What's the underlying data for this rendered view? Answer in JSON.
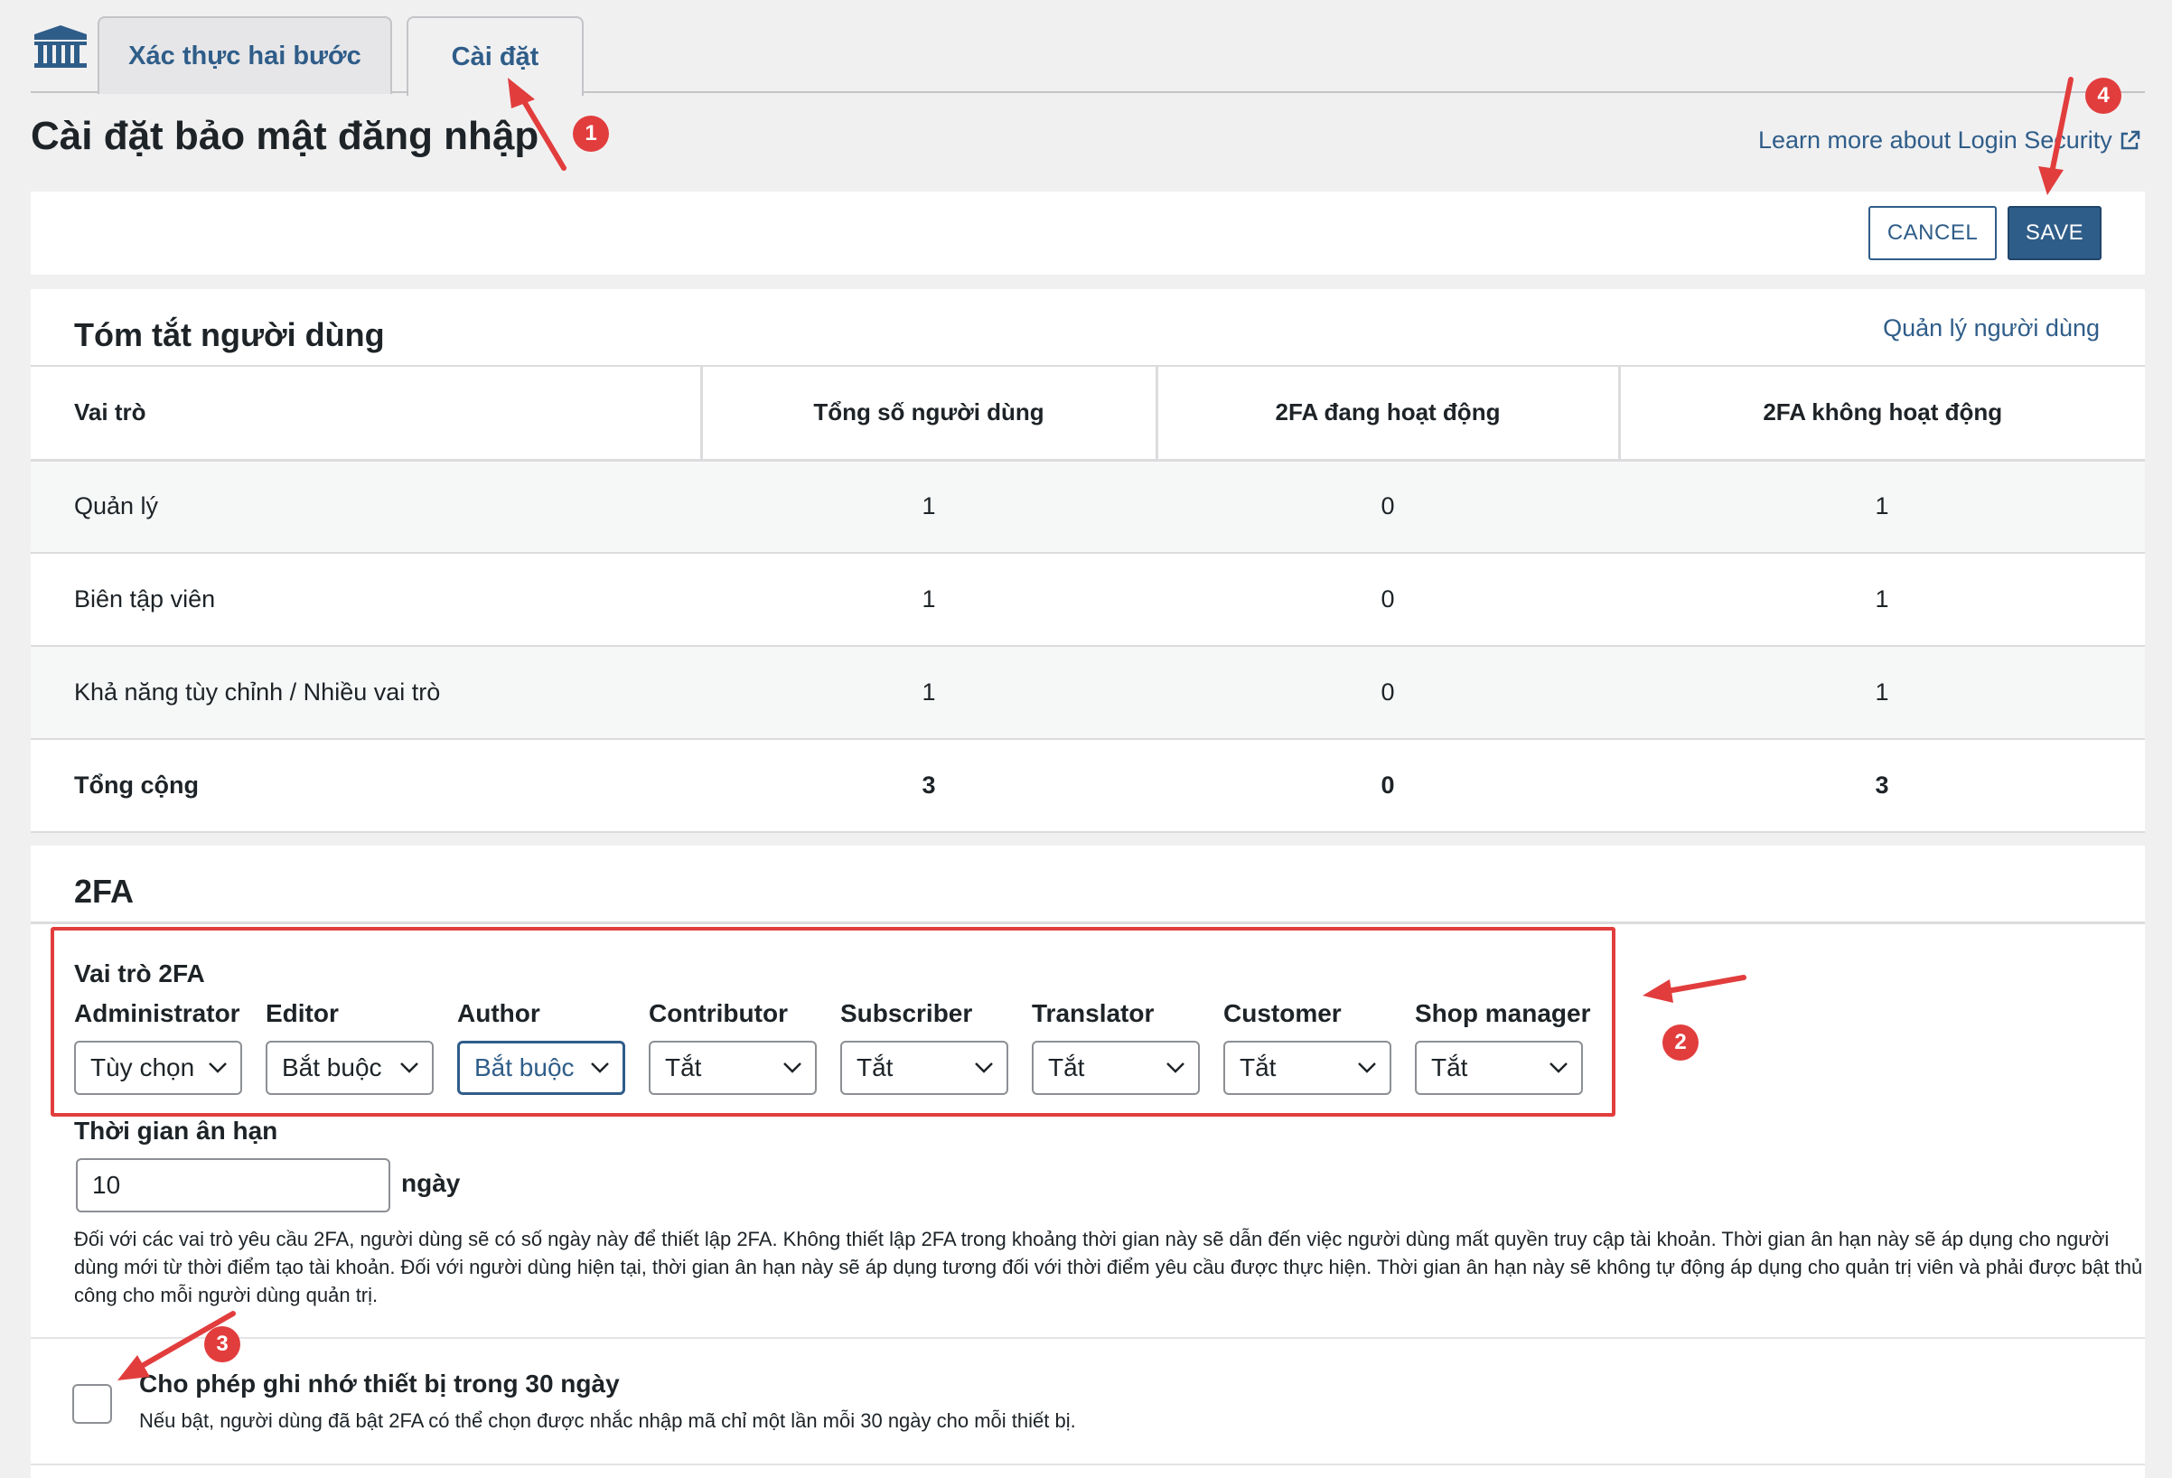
{
  "tabs": [
    {
      "label": "Xác thực hai bước"
    },
    {
      "label": "Cài đặt"
    }
  ],
  "page": {
    "title": "Cài đặt bảo mật đăng nhập",
    "learn_more": "Learn more about Login Security"
  },
  "actions": {
    "cancel": "CANCEL",
    "save": "SAVE"
  },
  "summary": {
    "title": "Tóm tắt người dùng",
    "manage_link": "Quản lý người dùng",
    "headers": [
      "Vai trò",
      "Tổng số người dùng",
      "2FA đang hoạt động",
      "2FA không hoạt động"
    ],
    "rows": [
      {
        "role": "Quản lý",
        "total": "1",
        "active": "0",
        "inactive": "1"
      },
      {
        "role": "Biên tập viên",
        "total": "1",
        "active": "0",
        "inactive": "1"
      },
      {
        "role": "Khả năng tùy chỉnh / Nhiều vai trò",
        "total": "1",
        "active": "0",
        "inactive": "1"
      }
    ],
    "total": {
      "role": "Tổng cộng",
      "total": "3",
      "active": "0",
      "inactive": "3"
    }
  },
  "twofa": {
    "title": "2FA",
    "roles_label": "Vai trò 2FA",
    "roles": [
      {
        "name": "Administrator",
        "value": "Tùy chọn"
      },
      {
        "name": "Editor",
        "value": "Bắt buộc"
      },
      {
        "name": "Author",
        "value": "Bắt buộc"
      },
      {
        "name": "Contributor",
        "value": "Tắt"
      },
      {
        "name": "Subscriber",
        "value": "Tắt"
      },
      {
        "name": "Translator",
        "value": "Tắt"
      },
      {
        "name": "Customer",
        "value": "Tắt"
      },
      {
        "name": "Shop manager",
        "value": "Tắt"
      }
    ],
    "grace_label": "Thời gian ân hạn",
    "grace_value": "10",
    "grace_unit": "ngày",
    "grace_desc": "Đối với các vai trò yêu cầu 2FA, người dùng sẽ có số ngày này để thiết lập 2FA. Không thiết lập 2FA trong khoảng thời gian này sẽ dẫn đến việc người dùng mất quyền truy cập tài khoản. Thời gian ân hạn này sẽ áp dụng cho người dùng mới từ thời điểm tạo tài khoản. Đối với người dùng hiện tại, thời gian ân hạn này sẽ áp dụng tương đối với thời điểm yêu cầu được thực hiện. Thời gian ân hạn này sẽ không tự động áp dụng cho quản trị viên và phải được bật thủ công cho mỗi người dùng quản trị.",
    "remember_label": "Cho phép ghi nhớ thiết bị trong 30 ngày",
    "remember_desc": "Nếu bật, người dùng đã bật 2FA có thể chọn được nhắc nhập mã chỉ một lần mỗi 30 ngày cho mỗi thiết bị."
  },
  "annotations": [
    "1",
    "2",
    "3",
    "4"
  ],
  "colors": {
    "accent": "#2f5d89",
    "annotation": "#e23d3d"
  }
}
